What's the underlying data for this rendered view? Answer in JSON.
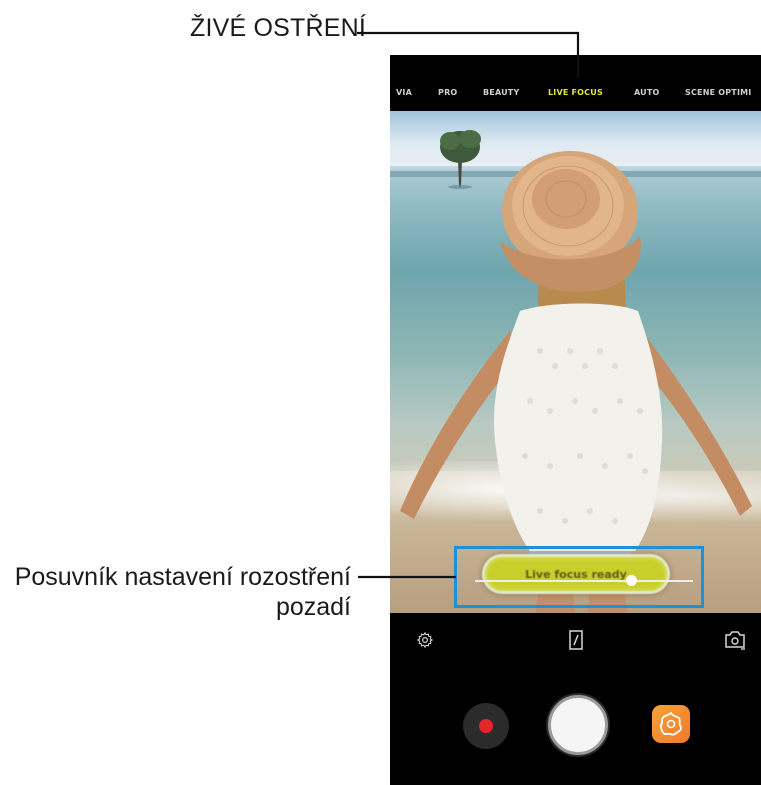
{
  "callouts": {
    "live_focus": "ŽIVÉ OSTŘENÍ",
    "slider_line1": "Posuvník nastavení rozostření",
    "slider_line2": "pozadí",
    "line_color": "#111111"
  },
  "camera": {
    "modes": [
      {
        "label": "VIA"
      },
      {
        "label": "PRO"
      },
      {
        "label": "BEAUTY"
      },
      {
        "label": "LIVE FOCUS",
        "active": true
      },
      {
        "label": "AUTO"
      },
      {
        "label": "SCENE OPTIMI"
      }
    ],
    "focus_status": "Live focus ready",
    "blur_slider_value": 0.72,
    "accent_color": "#e3e83a",
    "highlight_color": "#1f8fd6",
    "icons": {
      "settings": "gear-icon",
      "aspect": "aspect-ratio-icon",
      "switch": "switch-camera-icon",
      "record": "record-icon",
      "shutter": "shutter-icon",
      "sticker": "sticker-icon"
    }
  }
}
